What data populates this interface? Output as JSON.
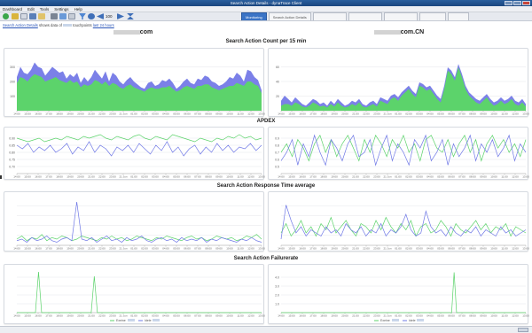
{
  "window": {
    "title": "Search Action Details - dynaTrace Client"
  },
  "menu": [
    "Dashboard",
    "Edit",
    "Tools",
    "Settings",
    "Help"
  ],
  "toolbar": {
    "zoom_value": "100"
  },
  "tabs": [
    {
      "label": "Monitoring",
      "active": true
    },
    {
      "label": "Search Action Details",
      "active": false
    },
    {
      "label": "",
      "active": false
    },
    {
      "label": "",
      "active": false
    },
    {
      "label": "",
      "active": false
    },
    {
      "label": "",
      "active": false
    },
    {
      "label": "",
      "active": false
    }
  ],
  "infobar": {
    "link": "Search Action Details",
    "text1": "shows data of",
    "text2": "touchpoints",
    "timeframe": "last 24 hours"
  },
  "hosts": {
    "left": "com",
    "right": "com.CN"
  },
  "sections": {
    "count": "Search Action Count per 15 min",
    "apdex": "APDEX",
    "response": "Search Action Response Time average",
    "failure": "Search Action Failurerate"
  },
  "x_ticks": [
    "14:00",
    "15:00",
    "16:00",
    "17:00",
    "18:00",
    "19:00",
    "20:00",
    "21:00",
    "22:00",
    "23:00",
    "21 Jun",
    "01:00",
    "02:00",
    "03:00",
    "04:00",
    "05:00",
    "06:00",
    "07:00",
    "08:00",
    "09:00",
    "10:00",
    "11:00",
    "12:00",
    "13:00"
  ],
  "legend": {
    "item1": "Exeine",
    "item2": "Idele"
  },
  "colors": {
    "blue": "#6f78e6",
    "green": "#5cd36b",
    "grid": "#e4e6ea",
    "axis": "#999"
  },
  "chart_data": [
    {
      "id": "count-left",
      "type": "area",
      "yticks": [
        "100",
        "200",
        "300"
      ],
      "ymax": 400,
      "series": [
        {
          "color": "#7b80e8",
          "values": [
            230,
            300,
            260,
            250,
            280,
            330,
            300,
            290,
            240,
            270,
            300,
            280,
            260,
            270,
            220,
            250,
            230,
            260,
            190,
            230,
            200,
            230,
            280,
            250,
            220,
            270,
            200,
            260,
            240,
            200,
            180,
            210,
            230,
            200,
            180,
            160,
            150,
            190,
            200,
            170,
            180,
            210,
            200,
            220,
            190,
            150,
            170,
            200,
            220,
            190,
            180,
            220,
            210,
            240,
            230,
            200,
            190,
            170,
            180,
            200,
            230,
            220,
            260,
            240,
            200,
            280,
            270,
            230,
            210,
            140
          ]
        },
        {
          "color": "#5cd36b",
          "values": [
            190,
            230,
            220,
            200,
            230,
            250,
            240,
            230,
            200,
            210,
            220,
            230,
            210,
            200,
            190,
            210,
            190,
            200,
            160,
            180,
            170,
            180,
            210,
            200,
            180,
            200,
            170,
            190,
            180,
            160,
            150,
            170,
            180,
            160,
            150,
            140,
            130,
            150,
            160,
            150,
            150,
            160,
            160,
            170,
            150,
            130,
            140,
            160,
            170,
            160,
            150,
            170,
            170,
            180,
            180,
            160,
            150,
            140,
            150,
            160,
            170,
            170,
            190,
            180,
            170,
            200,
            200,
            180,
            170,
            120
          ]
        }
      ]
    },
    {
      "id": "count-right",
      "type": "area",
      "yticks": [
        "20",
        "40",
        "60"
      ],
      "ymax": 70,
      "series": [
        {
          "color": "#7b80e8",
          "values": [
            12,
            18,
            14,
            10,
            16,
            12,
            8,
            6,
            10,
            14,
            12,
            8,
            10,
            6,
            12,
            8,
            14,
            10,
            6,
            8,
            12,
            10,
            14,
            8,
            6,
            10,
            12,
            8,
            16,
            14,
            12,
            18,
            20,
            16,
            22,
            26,
            30,
            24,
            20,
            34,
            32,
            28,
            30,
            24,
            18,
            14,
            30,
            52,
            48,
            40,
            56,
            44,
            30,
            22,
            18,
            14,
            12,
            16,
            20,
            14,
            10,
            12,
            16,
            12,
            14,
            18,
            12,
            10,
            14,
            8
          ]
        },
        {
          "color": "#5cd36b",
          "values": [
            6,
            8,
            8,
            6,
            10,
            8,
            5,
            4,
            6,
            10,
            8,
            5,
            6,
            4,
            8,
            5,
            10,
            6,
            4,
            5,
            8,
            6,
            10,
            5,
            4,
            6,
            8,
            5,
            12,
            10,
            8,
            14,
            16,
            12,
            18,
            22,
            26,
            20,
            16,
            30,
            28,
            24,
            26,
            20,
            14,
            10,
            26,
            48,
            44,
            36,
            52,
            40,
            26,
            18,
            14,
            10,
            8,
            12,
            16,
            10,
            6,
            8,
            12,
            8,
            10,
            14,
            8,
            6,
            10,
            5
          ]
        }
      ]
    },
    {
      "id": "apdex-left",
      "type": "line",
      "yticks": [
        "0.70",
        "0.75",
        "0.80",
        "0.85",
        "0.90"
      ],
      "ymin": 0.68,
      "ymax": 0.92,
      "series": [
        {
          "color": "#5cd36b",
          "values": [
            0.88,
            0.87,
            0.86,
            0.87,
            0.88,
            0.86,
            0.87,
            0.88,
            0.87,
            0.89,
            0.88,
            0.87,
            0.89,
            0.88,
            0.89,
            0.9,
            0.88,
            0.87,
            0.89,
            0.88,
            0.87,
            0.89,
            0.9,
            0.88,
            0.87,
            0.89,
            0.88,
            0.87,
            0.9,
            0.89,
            0.88,
            0.87,
            0.86,
            0.88,
            0.87,
            0.86,
            0.88,
            0.87,
            0.89,
            0.88,
            0.9,
            0.88,
            0.89,
            0.87,
            0.88
          ]
        },
        {
          "color": "#6f78e6",
          "values": [
            0.84,
            0.82,
            0.85,
            0.8,
            0.83,
            0.81,
            0.84,
            0.8,
            0.82,
            0.85,
            0.79,
            0.83,
            0.81,
            0.86,
            0.8,
            0.84,
            0.82,
            0.78,
            0.83,
            0.81,
            0.84,
            0.8,
            0.85,
            0.82,
            0.79,
            0.84,
            0.81,
            0.86,
            0.8,
            0.83,
            0.78,
            0.82,
            0.84,
            0.79,
            0.83,
            0.8,
            0.85,
            0.81,
            0.84,
            0.8,
            0.83,
            0.82,
            0.85,
            0.81,
            0.84
          ]
        }
      ]
    },
    {
      "id": "apdex-right",
      "type": "line",
      "yticks": [
        "0.5",
        "0.6",
        "0.7",
        "0.8",
        "0.9"
      ],
      "ymin": 0.45,
      "ymax": 0.95,
      "series": [
        {
          "color": "#5cd36b",
          "values": [
            0.7,
            0.8,
            0.65,
            0.85,
            0.75,
            0.6,
            0.8,
            0.9,
            0.7,
            0.85,
            0.65,
            0.8,
            0.9,
            0.75,
            0.6,
            0.85,
            0.7,
            0.9,
            0.8,
            0.65,
            0.85,
            0.75,
            0.9,
            0.7,
            0.8,
            0.6,
            0.85,
            0.9,
            0.75,
            0.7,
            0.85,
            0.65,
            0.8,
            0.9,
            0.7,
            0.85,
            0.6,
            0.8,
            0.9,
            0.75,
            0.85,
            0.7,
            0.8,
            0.65,
            0.85
          ]
        },
        {
          "color": "#6f78e6",
          "values": [
            0.6,
            0.7,
            0.85,
            0.55,
            0.8,
            0.65,
            0.9,
            0.7,
            0.55,
            0.85,
            0.75,
            0.6,
            0.8,
            0.9,
            0.65,
            0.7,
            0.85,
            0.55,
            0.75,
            0.9,
            0.6,
            0.8,
            0.7,
            0.55,
            0.85,
            0.75,
            0.9,
            0.6,
            0.7,
            0.85,
            0.55,
            0.8,
            0.65,
            0.75,
            0.9,
            0.6,
            0.8,
            0.7,
            0.85,
            0.65,
            0.75,
            0.9,
            0.6,
            0.8,
            0.7
          ]
        }
      ]
    },
    {
      "id": "resp-left",
      "type": "line",
      "yticks": [
        "",
        "",
        "",
        ""
      ],
      "ymin": 0,
      "ymax": 32,
      "series": [
        {
          "color": "#5cd36b",
          "values": [
            4,
            6,
            3,
            5,
            4,
            7,
            3,
            5,
            4,
            6,
            5,
            3,
            4,
            6,
            5,
            4,
            3,
            5,
            4,
            6,
            4,
            5,
            3,
            4,
            6,
            5,
            4,
            3,
            5,
            4,
            6,
            5,
            4,
            3,
            5,
            6,
            4,
            5,
            3,
            4,
            6,
            5,
            4,
            5,
            3,
            4,
            6,
            5,
            7,
            4
          ]
        },
        {
          "color": "#6f78e6",
          "values": [
            3,
            4,
            2,
            5,
            3,
            4,
            6,
            3,
            2,
            4,
            5,
            3,
            28,
            4,
            3,
            5,
            2,
            4,
            6,
            3,
            4,
            2,
            5,
            3,
            4,
            6,
            3,
            2,
            4,
            5,
            3,
            4,
            2,
            5,
            3,
            4,
            3,
            5,
            2,
            4,
            3,
            5,
            4,
            3,
            2,
            4,
            3,
            5,
            3,
            2
          ]
        }
      ]
    },
    {
      "id": "resp-right",
      "type": "line",
      "yticks": [
        "",
        "",
        "",
        ""
      ],
      "ymin": 0,
      "ymax": 32,
      "series": [
        {
          "color": "#5cd36b",
          "values": [
            8,
            14,
            6,
            10,
            16,
            8,
            12,
            6,
            14,
            10,
            18,
            8,
            12,
            16,
            10,
            6,
            14,
            12,
            8,
            16,
            10,
            18,
            12,
            8,
            14,
            10,
            16,
            6,
            12,
            14,
            8,
            10,
            16,
            12,
            6,
            14,
            10,
            8,
            12,
            16,
            10,
            14,
            8,
            12,
            10,
            14,
            6,
            12,
            10,
            8
          ]
        },
        {
          "color": "#6f78e6",
          "values": [
            4,
            26,
            16,
            8,
            12,
            6,
            10,
            8,
            6,
            12,
            8,
            10,
            6,
            14,
            10,
            8,
            12,
            6,
            10,
            8,
            14,
            6,
            10,
            8,
            12,
            20,
            10,
            6,
            8,
            22,
            12,
            8,
            10,
            6,
            12,
            8,
            6,
            10,
            8,
            12,
            6,
            10,
            8,
            6,
            12,
            8,
            10,
            6,
            8,
            10
          ]
        }
      ]
    },
    {
      "id": "fail-left",
      "type": "line",
      "yticks": [
        "",
        "",
        "",
        ""
      ],
      "ymin": 0,
      "ymax": 1,
      "series": [
        {
          "color": "#5cd36b",
          "values": [
            0,
            0,
            0,
            0,
            0,
            0,
            0,
            0.92,
            0,
            0,
            0,
            0,
            0,
            0,
            0,
            0,
            0,
            0,
            0,
            0,
            0,
            0,
            0,
            0,
            0,
            0.82,
            0,
            0,
            0,
            0,
            0,
            0,
            0,
            0,
            0,
            0,
            0,
            0,
            0,
            0,
            0,
            0,
            0,
            0,
            0,
            0,
            0,
            0,
            0,
            0,
            0,
            0,
            0,
            0,
            0,
            0,
            0,
            0,
            0,
            0,
            0,
            0,
            0,
            0,
            0,
            0,
            0,
            0,
            0,
            0,
            0,
            0,
            0,
            0,
            0,
            0,
            0,
            0,
            0,
            0
          ]
        }
      ]
    },
    {
      "id": "fail-right",
      "type": "line",
      "yticks": [
        "1.0",
        "2.0",
        "3.0",
        "4.0"
      ],
      "ymin": 0,
      "ymax": 4.4,
      "series": [
        {
          "color": "#5cd36b",
          "values": [
            0,
            0,
            0,
            0,
            0,
            0,
            0,
            0,
            0,
            0,
            0,
            0,
            0,
            0,
            0,
            0,
            0,
            0,
            0,
            0,
            0,
            0,
            0,
            0,
            0,
            0,
            0,
            0,
            0,
            0,
            0,
            0,
            0,
            0,
            0,
            0,
            0,
            0,
            0,
            0,
            0,
            0,
            0,
            0,
            0,
            0,
            0,
            0,
            0,
            0,
            0,
            0,
            0,
            0,
            0,
            0,
            0,
            0,
            0,
            0,
            0,
            0,
            0,
            0,
            0,
            0,
            0,
            0,
            0,
            0,
            4.0,
            0,
            0,
            0,
            0,
            0,
            0,
            0,
            0,
            0,
            0,
            0,
            0,
            0,
            0,
            0,
            0,
            0,
            0,
            0,
            0,
            0,
            0,
            0,
            0,
            0,
            0,
            0,
            0,
            0
          ]
        }
      ]
    }
  ],
  "status": {
    "text": ""
  }
}
